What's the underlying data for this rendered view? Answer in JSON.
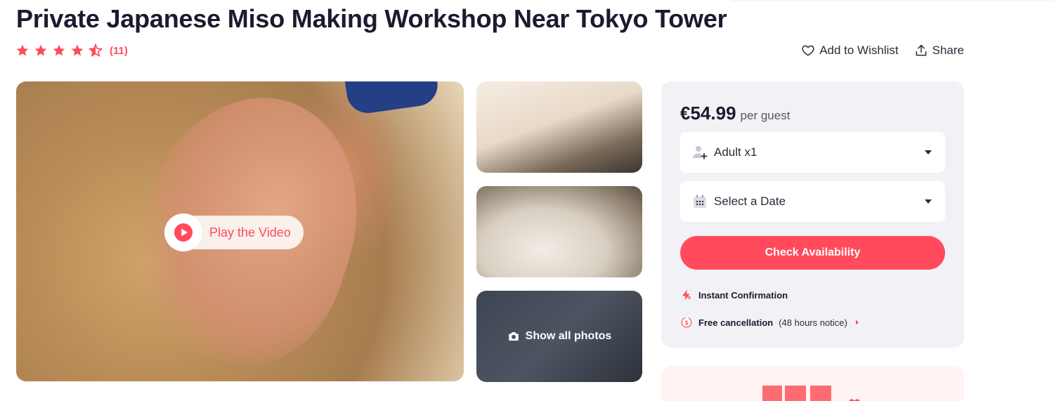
{
  "header": {
    "title": "Private Japanese Miso Making Workshop Near Tokyo Tower",
    "rating": {
      "stars": 4.5,
      "max": 5,
      "count_label": "(11)"
    },
    "actions": {
      "wishlist_label": "Add to Wishlist",
      "share_label": "Share"
    }
  },
  "gallery": {
    "play_label": "Play the Video",
    "show_all_label": "Show all photos"
  },
  "booking": {
    "price": "€54.99",
    "price_unit": "per guest",
    "guests_value": "Adult x1",
    "date_placeholder": "Select a Date",
    "cta_label": "Check Availability",
    "features": [
      {
        "bold": "Instant Confirmation",
        "extra": ""
      },
      {
        "bold": "Free cancellation",
        "extra": "(48 hours notice)"
      }
    ]
  },
  "colors": {
    "accent": "#ff4b5c",
    "panel_bg": "#f2f2f6",
    "text": "#1b1b2f"
  },
  "icons": {
    "star": "star-icon",
    "heart": "heart-icon",
    "share": "share-icon",
    "play": "play-icon",
    "camera": "camera-icon",
    "user": "user-add-icon",
    "calendar": "calendar-icon",
    "bolt": "bolt-icon",
    "refund": "refund-icon"
  }
}
